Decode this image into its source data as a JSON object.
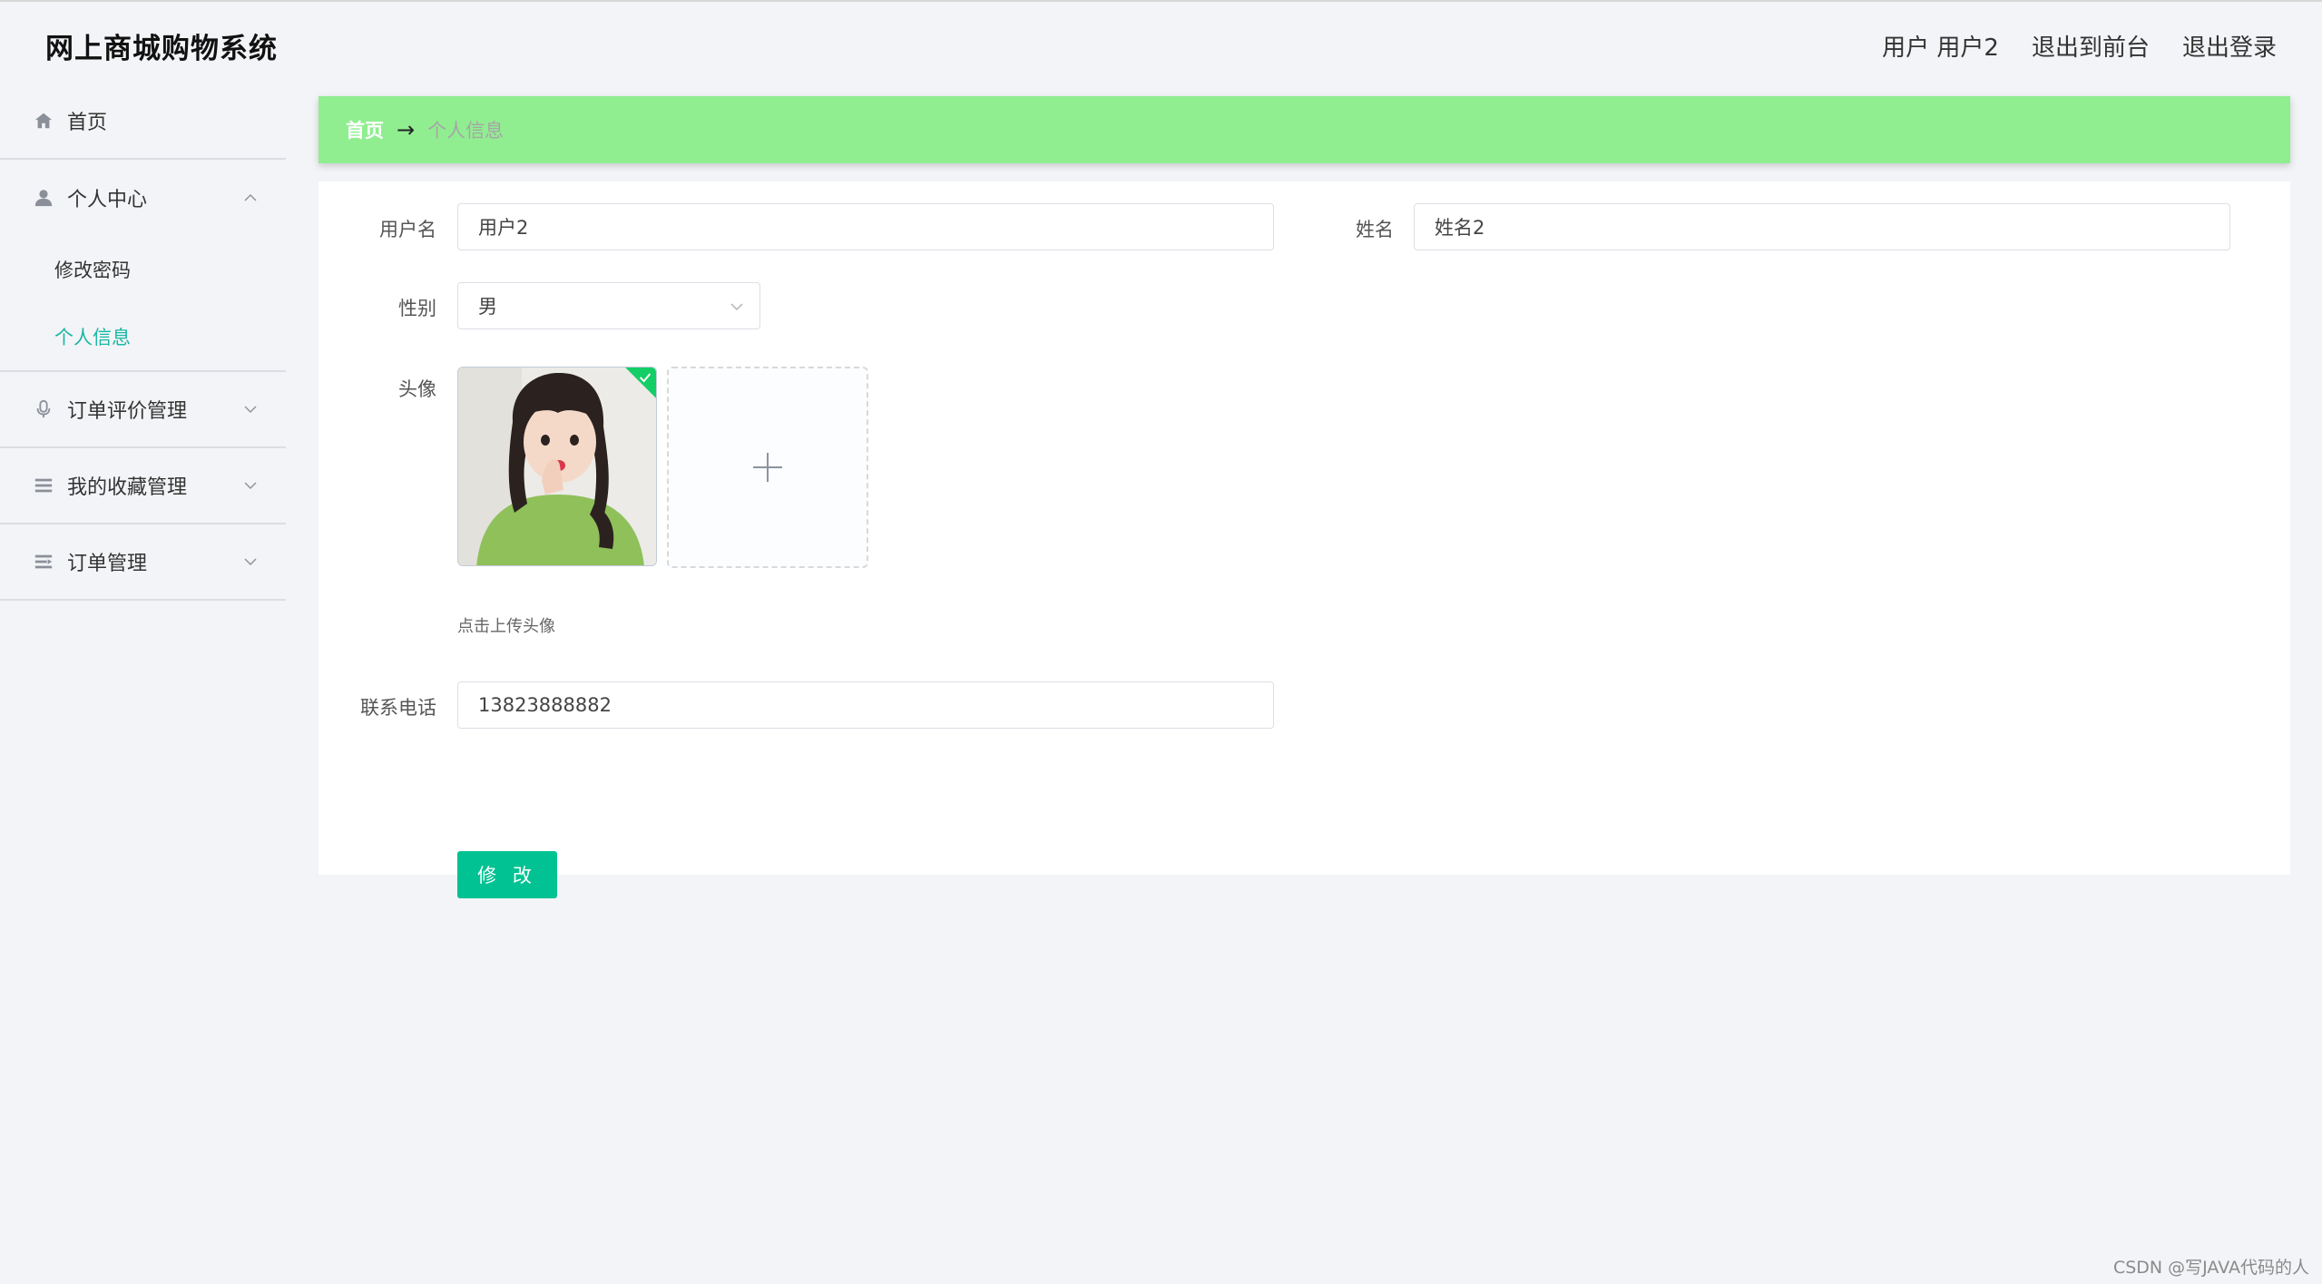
{
  "header": {
    "title": "网上商城购物系统",
    "user_label": "用户 用户2",
    "front_link": "退出到前台",
    "logout_link": "退出登录"
  },
  "sidebar": {
    "items": [
      {
        "label": "首页",
        "icon": "home-icon"
      },
      {
        "label": "个人中心",
        "icon": "user-icon",
        "expanded": true,
        "children": [
          {
            "label": "修改密码",
            "active": false
          },
          {
            "label": "个人信息",
            "active": true
          }
        ]
      },
      {
        "label": "订单评价管理",
        "icon": "microphone-icon",
        "expanded": false
      },
      {
        "label": "我的收藏管理",
        "icon": "list-icon",
        "expanded": false
      },
      {
        "label": "订单管理",
        "icon": "list-arrow-icon",
        "expanded": false
      }
    ]
  },
  "breadcrumb": {
    "home": "首页",
    "separator": "→",
    "current": "个人信息"
  },
  "form": {
    "username": {
      "label": "用户名",
      "value": "用户2"
    },
    "name": {
      "label": "姓名",
      "value": "姓名2"
    },
    "gender": {
      "label": "性别",
      "value": "男"
    },
    "avatar": {
      "label": "头像",
      "hint": "点击上传头像"
    },
    "phone": {
      "label": "联系电话",
      "value": "13823888882"
    },
    "submit_label": "修 改"
  },
  "watermark": "CSDN @写JAVA代码的人",
  "colors": {
    "accent": "#1bb7a4",
    "breadcrumb_bg": "#90ee90",
    "button": "#00c292",
    "success_corner": "#13ce66"
  }
}
